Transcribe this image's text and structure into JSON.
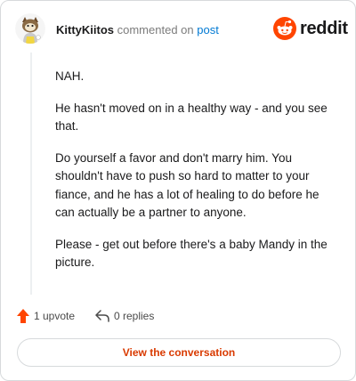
{
  "header": {
    "username": "KittyKiitos",
    "commented_text": "commented on",
    "post_link": "post",
    "logo_text": "reddit"
  },
  "comment": {
    "paragraphs": [
      "NAH.",
      "He hasn't moved on in a healthy way - and you see that.",
      "Do yourself a favor and don't marry him. You shouldn't have to push so hard to matter to your fiance, and he has a lot of healing to do before he can actually be a partner to anyone.",
      "Please - get out before there's a baby Mandy in the picture."
    ]
  },
  "actions": {
    "upvotes": "1 upvote",
    "replies": "0 replies"
  },
  "cta": {
    "label": "View the conversation"
  },
  "colors": {
    "accent": "#d93a00",
    "reddit_orange": "#ff4500",
    "upvote": "#ff4500",
    "link": "#0079d3"
  }
}
